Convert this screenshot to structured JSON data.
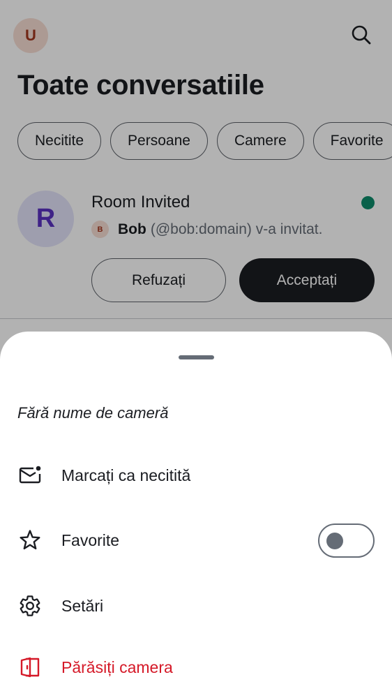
{
  "header": {
    "user_avatar_initial": "U",
    "title": "Toate conversatiile"
  },
  "filters": [
    "Necitite",
    "Persoane",
    "Camere",
    "Favorite"
  ],
  "room": {
    "avatar_initial": "R",
    "name": "Room Invited",
    "inviter_avatar_initial": "B",
    "inviter_name": "Bob",
    "invite_text": "(@bob:domain) v-a invitat.",
    "decline_label": "Refuzați",
    "accept_label": "Acceptați",
    "unread_indicator_color": "#0d8b6a"
  },
  "sheet": {
    "title": "Fără nume de cameră",
    "items": [
      {
        "label": "Marcați ca necitită",
        "icon": "mail-unread-icon"
      },
      {
        "label": "Favorite",
        "icon": "star-icon",
        "toggle_on": false
      },
      {
        "label": "Setări",
        "icon": "gear-icon"
      },
      {
        "label": "Părăsiți camera",
        "icon": "leave-door-icon",
        "danger_color": "#d51928"
      }
    ]
  }
}
